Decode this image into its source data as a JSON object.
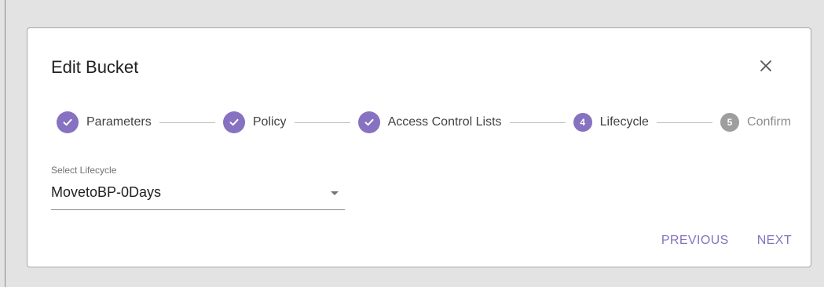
{
  "dialog": {
    "title": "Edit Bucket",
    "close_icon": "close-icon"
  },
  "stepper": {
    "steps": [
      {
        "label": "Parameters",
        "status": "completed",
        "icon": "check-icon"
      },
      {
        "label": "Policy",
        "status": "completed",
        "icon": "check-icon"
      },
      {
        "label": "Access Control Lists",
        "status": "completed",
        "icon": "check-icon"
      },
      {
        "label": "Lifecycle",
        "status": "active",
        "number": "4"
      },
      {
        "label": "Confirm",
        "status": "inactive",
        "number": "5"
      }
    ]
  },
  "lifecycle_select": {
    "label": "Select Lifecycle",
    "value": "MovetoBP-0Days",
    "icon": "chevron-down-icon"
  },
  "actions": {
    "previous_label": "PREVIOUS",
    "next_label": "NEXT"
  },
  "colors": {
    "accent": "#8672c0",
    "inactive": "#9e9e9e",
    "background": "#e3e3e3"
  }
}
